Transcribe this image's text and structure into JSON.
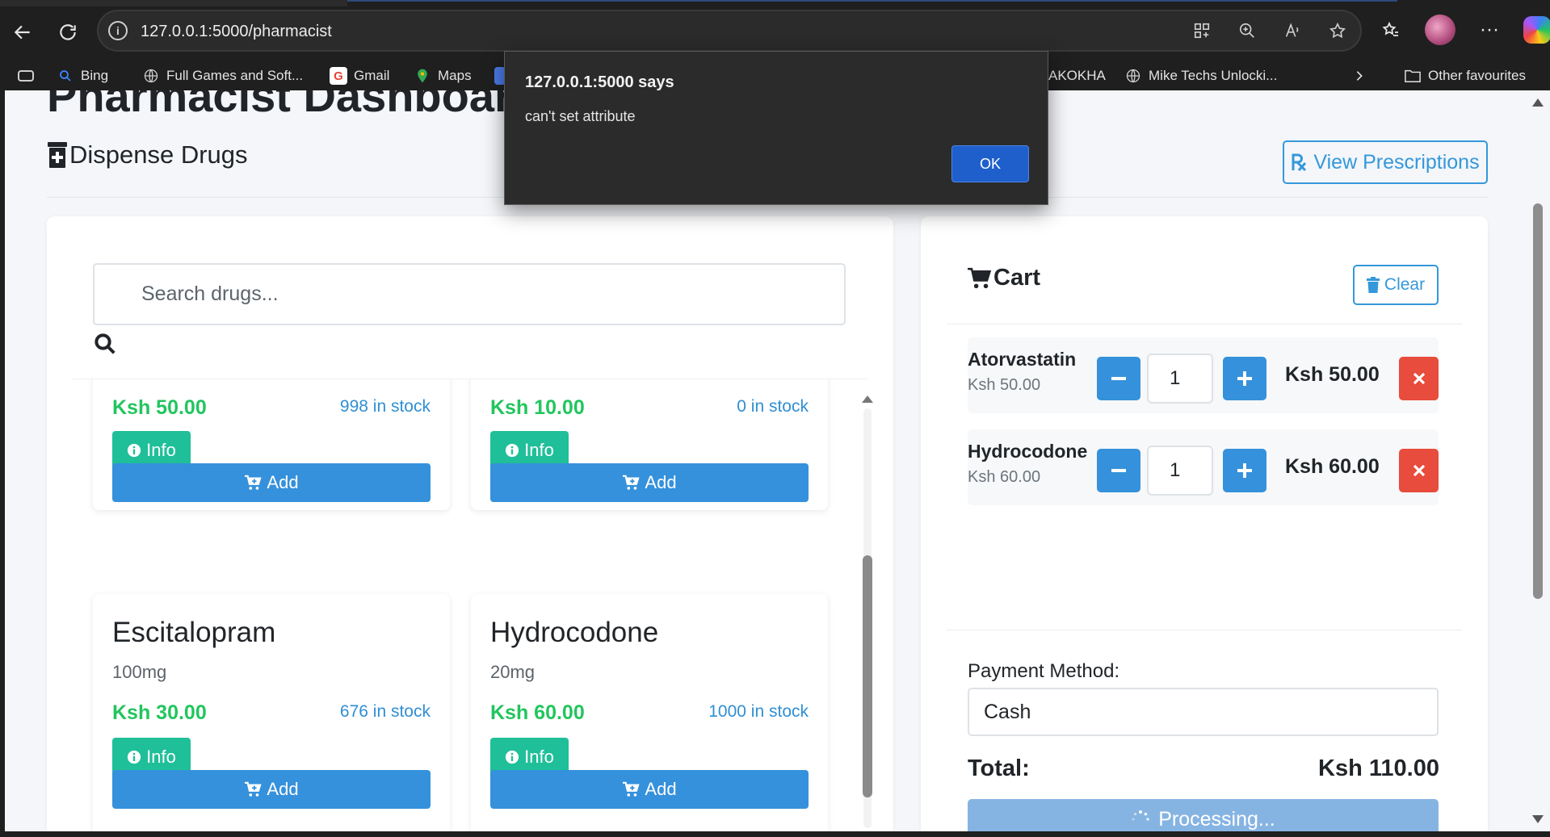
{
  "browser": {
    "url": "127.0.0.1:5000/pharmacist",
    "bookmarks": [
      {
        "label": "Bing",
        "icon": "bing-search-icon"
      },
      {
        "label": "Full Games and Soft...",
        "icon": "globe-icon"
      },
      {
        "label": "Gmail",
        "icon": "google-icon"
      },
      {
        "label": "Maps",
        "icon": "maps-pin-icon"
      },
      {
        "label": "AKOKHA",
        "icon": ""
      },
      {
        "label": "Mike Techs Unlocki...",
        "icon": "globe-icon"
      },
      {
        "label": "Other favourites",
        "icon": "folder-icon"
      }
    ]
  },
  "alert": {
    "title": "127.0.0.1:5000 says",
    "message": "can't set attribute",
    "ok_label": "OK"
  },
  "page": {
    "title": "Pharmacist Dashboard",
    "section_title": "Dispense Drugs",
    "view_prescriptions_label": "View Prescriptions"
  },
  "search": {
    "placeholder": "Search drugs..."
  },
  "drugs": [
    {
      "name": "",
      "strength": "",
      "price": "Ksh 50.00",
      "stock": "998 in stock",
      "info_label": "Info",
      "add_label": "Add"
    },
    {
      "name": "",
      "strength": "",
      "price": "Ksh 10.00",
      "stock": "0 in stock",
      "info_label": "Info",
      "add_label": "Add"
    },
    {
      "name": "Escitalopram",
      "strength": "100mg",
      "price": "Ksh 30.00",
      "stock": "676 in stock",
      "info_label": "Info",
      "add_label": "Add"
    },
    {
      "name": "Hydrocodone",
      "strength": "20mg",
      "price": "Ksh 60.00",
      "stock": "1000 in stock",
      "info_label": "Info",
      "add_label": "Add"
    }
  ],
  "cart": {
    "title": "Cart",
    "clear_label": "Clear",
    "items": [
      {
        "name": "Atorvastatin",
        "unit_price": "Ksh 50.00",
        "quantity": "1",
        "line_total": "Ksh 50.00"
      },
      {
        "name": "Hydrocodone",
        "unit_price": "Ksh 60.00",
        "quantity": "1",
        "line_total": "Ksh 60.00"
      }
    ],
    "payment_label": "Payment Method:",
    "payment_value": "Cash",
    "total_label": "Total:",
    "total_value": "Ksh 110.00",
    "process_label": "Processing..."
  },
  "colors": {
    "primary": "#3591db",
    "success": "#1fbf99",
    "price_green": "#22c55e",
    "danger": "#e74c3c"
  }
}
